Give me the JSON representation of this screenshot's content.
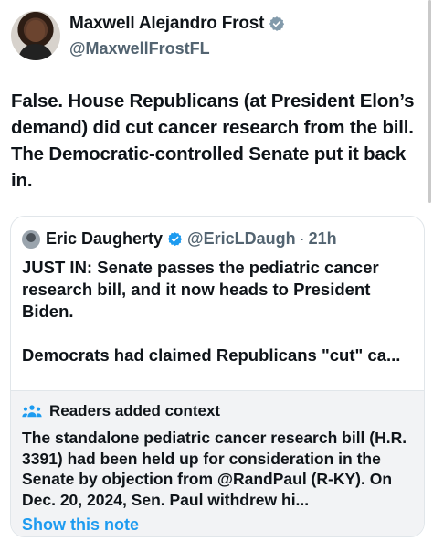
{
  "post": {
    "author_name": "Maxwell Alejandro Frost",
    "author_handle": "@MaxwellFrostFL",
    "text": "False. House Republicans (at President Elon’s demand) did cut cancer research from the bill. The Democratic-controlled Senate put it back in."
  },
  "quoted": {
    "author_name": "Eric Daugherty",
    "author_handle": "@EricLDaugh",
    "separator": "·",
    "time": "21h",
    "text": "JUST IN: Senate passes the pediatric cancer research bill, and it now heads to President Biden.\n\nDemocrats had claimed Republicans \"cut\" ca..."
  },
  "community_note": {
    "title": "Readers added context",
    "text": "The standalone pediatric cancer research bill (H.R. 3391) had been held up for consideration in the Senate by objection from @RandPaul (R-KY). On Dec. 20, 2024, Sen. Paul withdrew hi...",
    "link_label": "Show this note"
  },
  "colors": {
    "verified_badge": "#829aab",
    "link": "#1d9bf0",
    "notes_bg": "#f2f3f5"
  },
  "icons": {
    "badge": "verified-badge-icon",
    "notes": "people-icon"
  }
}
